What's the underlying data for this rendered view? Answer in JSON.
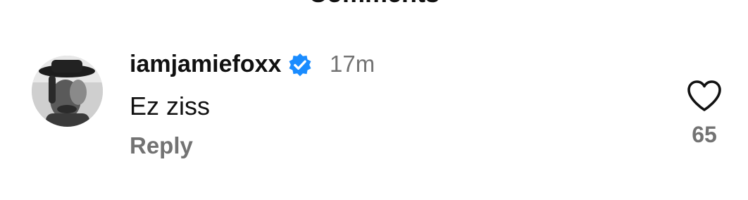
{
  "header": {
    "title": "Comments"
  },
  "comment": {
    "username": "iamjamiefoxx",
    "verified": true,
    "timestamp": "17m",
    "text": "Ez ziss",
    "reply_label": "Reply",
    "like_count": "65",
    "icons": {
      "avatar": "avatar",
      "verified": "verified-badge-icon",
      "like": "heart-outline-icon"
    }
  },
  "colors": {
    "verified_blue": "#1a8cff",
    "muted_gray": "#737373",
    "text": "#111111"
  }
}
